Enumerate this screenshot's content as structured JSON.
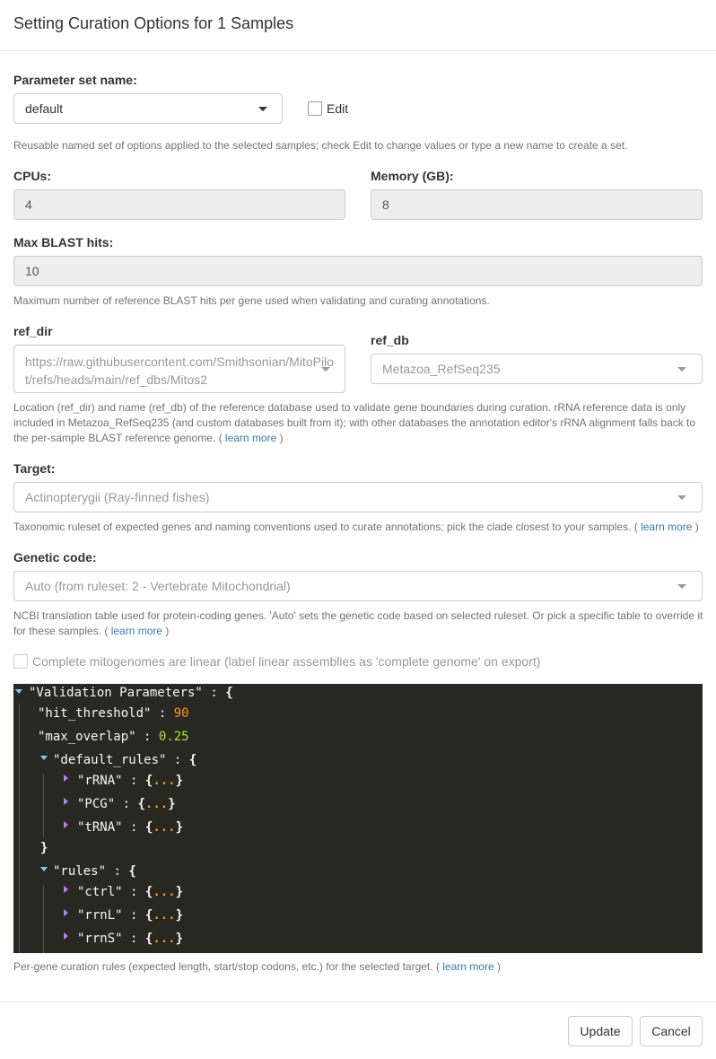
{
  "modal": {
    "title": "Setting Curation Options for 1 Samples"
  },
  "param_set": {
    "label": "Parameter set name:",
    "value": "default",
    "edit_label": "Edit",
    "edit_checked": false,
    "help": "Reusable named set of options applied to the selected samples; check Edit to change values or type a new name to create a set."
  },
  "cpus": {
    "label": "CPUs:",
    "value": "4"
  },
  "memory": {
    "label": "Memory (GB):",
    "value": "8"
  },
  "max_blast": {
    "label": "Max BLAST hits:",
    "value": "10",
    "help": "Maximum number of reference BLAST hits per gene used when validating and curating annotations."
  },
  "ref_dir": {
    "label": "ref_dir",
    "value_line1": "https://raw.githubusercontent.com/Smithsonian/MitoPilo",
    "value_line2": "t/refs/heads/main/ref_dbs/Mitos2"
  },
  "ref_db": {
    "label": "ref_db",
    "value": "Metazoa_RefSeq235"
  },
  "ref_help": {
    "line1": "Location (ref_dir) and name (ref_db) of the reference database used to validate gene boundaries during curation. rRNA reference data is only",
    "line2": "included in Metazoa_RefSeq235 (and custom databases built from it); with other databases the annotation editor's rRNA alignment falls back to",
    "line3_prefix": "the per-sample BLAST reference genome. (",
    "link": "learn more",
    "suffix": ")"
  },
  "target": {
    "label": "Target:",
    "value": "Actinopterygii (Ray-finned fishes)",
    "help_prefix": "Taxonomic ruleset of expected genes and naming conventions used to curate annotations; pick the clade closest to your samples. (",
    "link": "learn more",
    "suffix": ")"
  },
  "genetic_code": {
    "label": "Genetic code:",
    "value": "Auto (from ruleset: 2 - Vertebrate Mitochondrial)",
    "help_line1": "NCBI translation table used for protein-coding genes. 'Auto' sets the genetic code based on selected ruleset. Or pick a specific table to override it",
    "help_line2_prefix": "for these samples. (",
    "link": "learn more",
    "suffix": ")"
  },
  "linear": {
    "label": "Complete mitogenomes are linear (label linear assemblies as 'complete genome' on export)",
    "checked": false
  },
  "json_view": {
    "root_key": "\"Validation Parameters\"",
    "hit_threshold_key": "\"hit_threshold\"",
    "hit_threshold_val": "90",
    "max_overlap_key": "\"max_overlap\"",
    "max_overlap_val": "0.25",
    "default_rules_key": "\"default_rules\"",
    "default_rules_items": [
      "\"rRNA\"",
      "\"PCG\"",
      "\"tRNA\""
    ],
    "rules_key": "\"rules\"",
    "rules_items": [
      "\"ctrl\"",
      "\"rrnL\"",
      "\"rrnS\""
    ],
    "colon": ":",
    "open_brace": "{",
    "close_brace": "}",
    "dots": "...",
    "colors": {
      "background": "#272822",
      "number_int": "#fd971f",
      "number_float": "#a6e22e",
      "expand_arrow": "#66d9ef",
      "collapsed_arrow": "#ae81ff"
    }
  },
  "rules_help": {
    "prefix": "Per-gene curation rules (expected length, start/stop codons, etc.) for the selected target. (",
    "link": "learn more",
    "suffix": ")"
  },
  "footer": {
    "update_label": "Update",
    "cancel_label": "Cancel"
  }
}
